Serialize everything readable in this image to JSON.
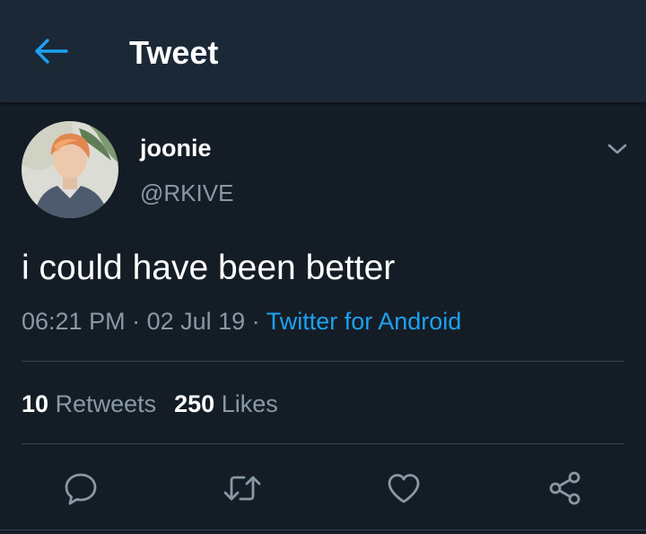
{
  "header": {
    "title": "Tweet",
    "back_icon": "arrow-left-icon",
    "accent_color": "#1da1f2"
  },
  "tweet": {
    "author": {
      "display_name": "joonie",
      "handle": "@RKIVE"
    },
    "text": "i could have been better",
    "time": "06:21 PM",
    "date": "02 Jul 19",
    "separator": " · ",
    "source": "Twitter for Android",
    "stats": {
      "retweets_count": "10",
      "retweets_label": "Retweets",
      "likes_count": "250",
      "likes_label": "Likes"
    }
  },
  "actions": [
    {
      "name": "reply",
      "icon": "reply-icon"
    },
    {
      "name": "retweet",
      "icon": "retweet-icon"
    },
    {
      "name": "like",
      "icon": "heart-icon"
    },
    {
      "name": "share",
      "icon": "share-icon"
    }
  ],
  "colors": {
    "background": "#141d26",
    "header_background": "#1b2836",
    "secondary_text": "#8899a6",
    "divider": "#38444d",
    "link": "#1da1f2"
  }
}
